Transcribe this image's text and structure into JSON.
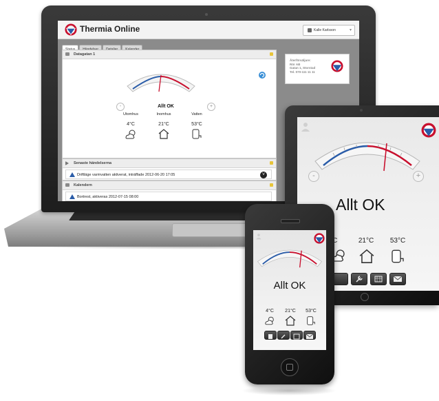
{
  "colors": {
    "brand_red": "#c8102e",
    "brand_blue": "#2a5ca8",
    "warning": "#e8c53a"
  },
  "laptop": {
    "app_title": "Thermia Online",
    "user_name": "Kalle Karlsson",
    "tabs": [
      {
        "label": "Status",
        "active": true
      },
      {
        "label": "Händelser",
        "active": false
      },
      {
        "label": "Detaljer",
        "active": false
      },
      {
        "label": "Kalender",
        "active": false
      }
    ],
    "device_panel": {
      "title": "Datagatan 1",
      "status": "Allt OK",
      "gauge_minus": "-",
      "gauge_plus": "+",
      "readings": [
        {
          "label": "Utomhus",
          "value": "4°C",
          "icon": "weather-icon"
        },
        {
          "label": "Inomhus",
          "value": "21°C",
          "icon": "house-icon"
        },
        {
          "label": "Vatten",
          "value": "53°C",
          "icon": "water-tank-icon"
        }
      ]
    },
    "events_panel": {
      "title": "Senaste händelserna",
      "event": "Driftläge varmvatten aktiverat, inträffade 2012-06-20 17:05"
    },
    "calendar_panel": {
      "title": "Kalendern",
      "event": "Bortrest, aktiveras 2012-07-15 08:00"
    },
    "dealer": {
      "heading": "Återförsäljare:",
      "name": "Rör AB",
      "address": "Gatan 1, Storstad",
      "phone": "Tel. 070-111 11 11"
    }
  },
  "tablet": {
    "status": "Allt OK",
    "minus": "-",
    "plus": "+",
    "readings": [
      {
        "value": "4°C",
        "icon": "weather-icon"
      },
      {
        "value": "21°C",
        "icon": "house-icon"
      },
      {
        "value": "53°C",
        "icon": "water-tank-icon"
      }
    ],
    "bottom_buttons": [
      "event-log-icon",
      "wrench-icon",
      "calendar-icon",
      "mail-icon"
    ]
  },
  "phone": {
    "status": "Allt OK",
    "readings": [
      {
        "value": "4°C",
        "icon": "weather-icon"
      },
      {
        "value": "21°C",
        "icon": "house-icon"
      },
      {
        "value": "53°C",
        "icon": "water-tank-icon"
      }
    ],
    "bottom_buttons": [
      "event-log-icon",
      "wrench-icon",
      "calendar-icon",
      "mail-icon"
    ]
  }
}
